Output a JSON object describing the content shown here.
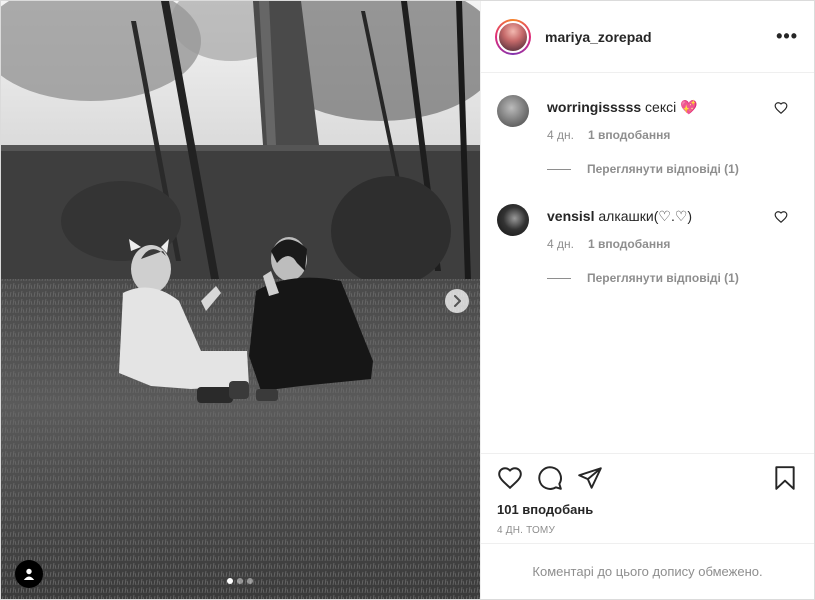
{
  "header": {
    "username": "mariya_zorepad",
    "more_label": "•••"
  },
  "comments": [
    {
      "username": "worringisssss",
      "text": "сексі",
      "emoji": "💖",
      "age": "4 дн.",
      "likes": "1 вподобання",
      "view_replies": "Переглянути відповіді (1)"
    },
    {
      "username": "vensisl",
      "text": "алкашки(♡.♡)",
      "age": "4 дн.",
      "likes": "1 вподобання",
      "view_replies": "Переглянути відповіді (1)"
    }
  ],
  "post": {
    "likes": "101 вподобань",
    "time": "4 ДН. ТОМУ",
    "comments_limited": "Коментарі до цього допису обмежено."
  },
  "carousel": {
    "current": 1,
    "total": 3
  },
  "icons": {
    "like": "heart-outline-icon",
    "comment": "speech-bubble-icon",
    "share": "paper-plane-icon",
    "save": "bookmark-icon",
    "next": "chevron-right-icon",
    "tagged_user": "user-silhouette-icon"
  }
}
